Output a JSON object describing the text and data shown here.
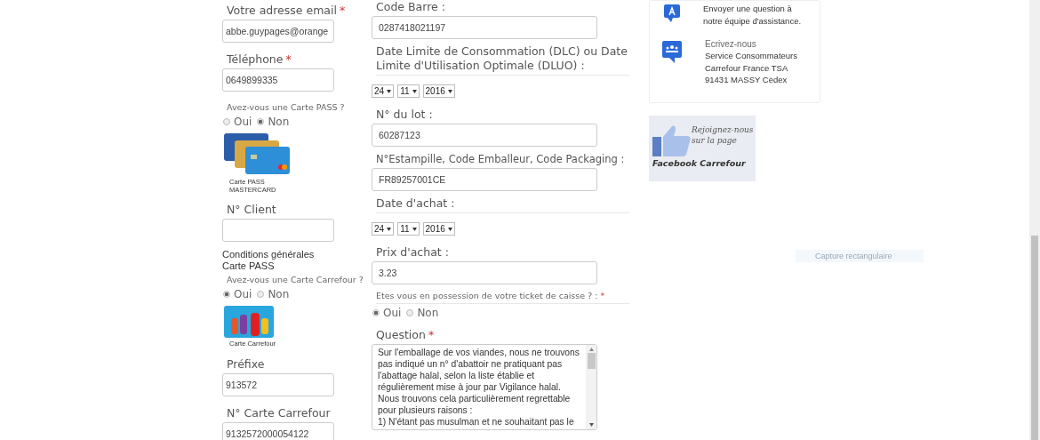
{
  "left_column": [
    {
      "kind": "text_field",
      "label": "Votre adresse email",
      "required_mark": "*",
      "value": "abbe.guypages@orange"
    },
    {
      "kind": "text_field",
      "label": "Téléphone",
      "required_mark": "*",
      "value": "0649899335"
    },
    {
      "kind": "radio_question",
      "label": "Avez-vous une Carte PASS ?",
      "options": [
        {
          "label": "Oui",
          "selected": false
        },
        {
          "label": "Non",
          "selected": true
        }
      ]
    },
    {
      "kind": "pass_card",
      "caption_lines": [
        "Carte PASS",
        "MASTERCARD"
      ]
    },
    {
      "kind": "text_field",
      "label": "N° Client"
    },
    {
      "kind": "link",
      "text": "Conditions générales Carte PASS"
    },
    {
      "kind": "radio_question",
      "label": "Avez-vous une Carte Carrefour ?",
      "options": [
        {
          "label": "Oui",
          "selected": true
        },
        {
          "label": "Non",
          "selected": false
        }
      ]
    },
    {
      "kind": "carrefour_card",
      "caption_lines": [
        "Carte Carrefour"
      ]
    },
    {
      "kind": "text_field",
      "label": "Préfixe",
      "value": "913572"
    },
    {
      "kind": "text_field",
      "label": "N° Carte Carrefour",
      "value": "9132572000054122"
    }
  ],
  "middle_column": [
    {
      "kind": "text_field",
      "label": "Code Barre :",
      "value": "0287418021197"
    },
    {
      "kind": "date_select",
      "label": "Date Limite de Consommation (DLC) ou Date Limite d'Utilisation Optimale (DLUO) :",
      "day": "24",
      "month": "11",
      "year": "2016"
    },
    {
      "kind": "text_field",
      "label": "N° du lot :",
      "value": "60287123"
    },
    {
      "kind": "text_field",
      "label": "N°Estampille, Code Emballeur, Code Packaging :",
      "value": "FR89257001CE"
    },
    {
      "kind": "date_select",
      "label": "Date d'achat :",
      "day": "24",
      "month": "11",
      "year": "2016"
    },
    {
      "kind": "text_field",
      "label": "Prix d'achat :",
      "value": "3.23"
    },
    {
      "kind": "radio_question",
      "label": "Etes vous en possession de votre ticket de caisse ? :",
      "required_mark": "*",
      "options": [
        {
          "label": "Oui",
          "selected": true
        },
        {
          "label": "Non",
          "selected": false
        }
      ]
    },
    {
      "kind": "textarea",
      "label": "Question",
      "required_mark": "*",
      "value": "Sur l'emballage de vos viandes, nous ne trouvons pas indiqué un n° d'abattoir ne pratiquant pas l'abattage halal, selon la liste établie et régulièrement mise à jour par Vigilance halal. Nous trouvons cela particulièrement regrettable pour plusieurs raisons :\n1) N'étant pas musulman et ne souhaitant pas le"
    }
  ],
  "contact_card": [
    {
      "kind": "question",
      "lines": [
        "Envoyer une question à",
        "notre équipe d'assistance."
      ]
    },
    {
      "kind": "mail",
      "heading": "Ecrivez-nous",
      "lines": [
        "Service Consommateurs",
        "Carrefour France TSA",
        "91431 MASSY Cedex"
      ]
    }
  ],
  "facebook_banner": {
    "lines": [
      "Rejoignez-nous",
      "sur la page"
    ],
    "brand": "Facebook Carrefour"
  },
  "capture_tooltip": "Capture rectangulaire"
}
